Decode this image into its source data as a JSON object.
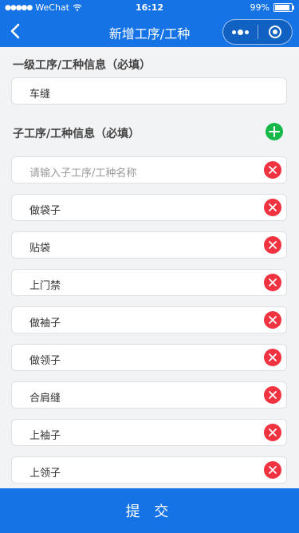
{
  "status": {
    "carrier": "WeChat",
    "time": "16:12",
    "battery": "99%"
  },
  "nav": {
    "title": "新增工序/工种"
  },
  "level1": {
    "title": "一级工序/工种信息（必填）",
    "value": "车缝"
  },
  "sub": {
    "title": "子工序/工种信息（必填）",
    "placeholder": "请输入子工序/工种名称",
    "items": [
      "做袋子",
      "贴袋",
      "上门禁",
      "做袖子",
      "做领子",
      "合肩缝",
      "上袖子",
      "上领子"
    ]
  },
  "submit_label": "提  交",
  "colors": {
    "primary": "#1573e5",
    "delete": "#ef3340",
    "add": "#16b84a"
  }
}
